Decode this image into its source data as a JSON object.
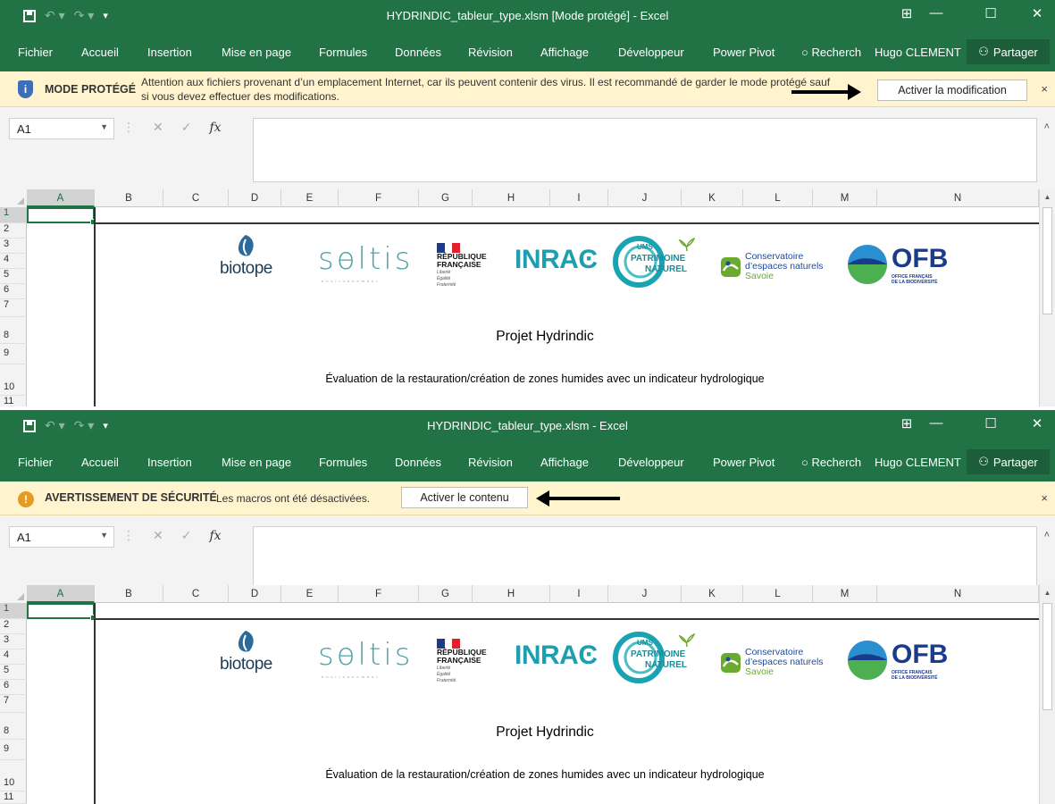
{
  "window1": {
    "app_title": "HYDRINDIC_tableur_type.xlsm  [Mode protégé] - Excel",
    "menu": [
      "Fichier",
      "Accueil",
      "Insertion",
      "Mise en page",
      "Formules",
      "Données",
      "Révision",
      "Affichage",
      "Développeur",
      "Power Pivot",
      "Recherch",
      "Hugo CLEMENT",
      "Partager"
    ],
    "message_bar": {
      "label": "MODE PROTÉGÉ",
      "text": "Attention aux fichiers provenant d’un emplacement Internet, car ils peuvent contenir des virus. Il est recommandé de garder le mode protégé sauf si vous devez effectuer des modifications.",
      "button": "Activer la modification",
      "close": "×"
    },
    "name_box": "A1"
  },
  "window2": {
    "app_title": "HYDRINDIC_tableur_type.xlsm - Excel",
    "menu": [
      "Fichier",
      "Accueil",
      "Insertion",
      "Mise en page",
      "Formules",
      "Données",
      "Révision",
      "Affichage",
      "Développeur",
      "Power Pivot",
      "Recherch",
      "Hugo CLEMENT",
      "Partager"
    ],
    "message_bar": {
      "label": "AVERTISSEMENT DE SÉCURITÉ",
      "text": "Les macros ont été désactivées.",
      "button": "Activer le contenu",
      "close": "×"
    },
    "name_box": "A1"
  },
  "grid": {
    "columns": [
      "A",
      "B",
      "C",
      "D",
      "E",
      "F",
      "G",
      "H",
      "I",
      "J",
      "K",
      "L",
      "M",
      "N"
    ],
    "rows": [
      "1",
      "2",
      "3",
      "4",
      "5",
      "6",
      "7",
      "8",
      "9",
      "10",
      "11"
    ]
  },
  "logos": {
    "biotope": "biotope",
    "soltis": "sɵltis",
    "soltis_sub": "environnement",
    "rf": [
      "RÉPUBLIQUE",
      "FRANÇAISE"
    ],
    "rf_motto": [
      "Liberté",
      "Égalité",
      "Fraternité"
    ],
    "inrae": "INRAϾ",
    "ums": [
      "UMS",
      "PATRIMOINE",
      "NATUREL"
    ],
    "cen": [
      "Conservatoire",
      "d’espaces naturels",
      "Savoie"
    ],
    "ofb": "OFB",
    "ofb_sub": [
      "OFFICE FRANÇAIS",
      "DE LA BIODIVERSITÉ"
    ]
  },
  "sheet_content": {
    "title": "Projet Hydrindic",
    "subtitle": "Évaluation de la restauration/création de zones humides avec un indicateur hydrologique"
  },
  "icons": {
    "fx": "fx",
    "cancel": "✕",
    "confirm": "✓",
    "tell_me": "💡",
    "close_window": "✕",
    "minimize": "—",
    "maximize": "☐",
    "ribbon_display": "⊞"
  },
  "colors": {
    "excel_green": "#217346",
    "message_bar": "#fff4ce",
    "shield": "#3c6fb6",
    "warning": "#e69a22"
  }
}
